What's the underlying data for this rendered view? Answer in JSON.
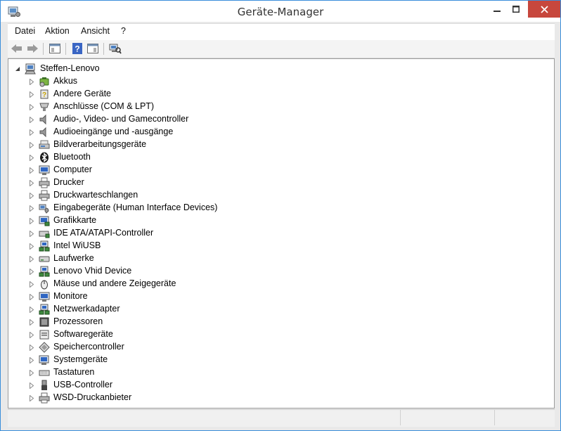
{
  "window": {
    "title": "Geräte-Manager"
  },
  "menu": {
    "items": [
      {
        "label": "Datei",
        "name": "menu-datei"
      },
      {
        "label": "Aktion",
        "name": "menu-aktion"
      },
      {
        "label": "Ansicht",
        "name": "menu-ansicht"
      },
      {
        "label": "?",
        "name": "menu-help"
      }
    ]
  },
  "toolbar": {
    "buttons": [
      "back-icon",
      "forward-icon",
      "properties-view-icon",
      "help-icon",
      "console-tree-icon",
      "scan-hardware-icon"
    ]
  },
  "tree": {
    "root": {
      "label": "Steffen-Lenovo",
      "icon": "computer-root-icon"
    },
    "items": [
      {
        "label": "Akkus",
        "icon": "battery-icon"
      },
      {
        "label": "Andere Geräte",
        "icon": "unknown-device-icon"
      },
      {
        "label": "Anschlüsse (COM & LPT)",
        "icon": "port-icon"
      },
      {
        "label": "Audio-, Video- und Gamecontroller",
        "icon": "speaker-icon"
      },
      {
        "label": "Audioeingänge und -ausgänge",
        "icon": "speaker-icon"
      },
      {
        "label": "Bildverarbeitungsgeräte",
        "icon": "scanner-icon"
      },
      {
        "label": "Bluetooth",
        "icon": "bluetooth-icon"
      },
      {
        "label": "Computer",
        "icon": "monitor-icon"
      },
      {
        "label": "Drucker",
        "icon": "printer-icon"
      },
      {
        "label": "Druckwarteschlangen",
        "icon": "printer-icon"
      },
      {
        "label": "Eingabegeräte (Human Interface Devices)",
        "icon": "hid-icon"
      },
      {
        "label": "Grafikkarte",
        "icon": "display-adapter-icon"
      },
      {
        "label": "IDE ATA/ATAPI-Controller",
        "icon": "drive-controller-icon"
      },
      {
        "label": "Intel WiUSB",
        "icon": "network-device-icon"
      },
      {
        "label": "Laufwerke",
        "icon": "disk-drive-icon"
      },
      {
        "label": "Lenovo Vhid Device",
        "icon": "network-device-icon"
      },
      {
        "label": "Mäuse und andere Zeigegeräte",
        "icon": "mouse-icon"
      },
      {
        "label": "Monitore",
        "icon": "monitor-icon"
      },
      {
        "label": "Netzwerkadapter",
        "icon": "network-device-icon"
      },
      {
        "label": "Prozessoren",
        "icon": "processor-icon"
      },
      {
        "label": "Softwaregeräte",
        "icon": "software-device-icon"
      },
      {
        "label": "Speichercontroller",
        "icon": "storage-controller-icon"
      },
      {
        "label": "Systemgeräte",
        "icon": "system-device-icon"
      },
      {
        "label": "Tastaturen",
        "icon": "keyboard-icon"
      },
      {
        "label": "USB-Controller",
        "icon": "usb-icon"
      },
      {
        "label": "WSD-Druckanbieter",
        "icon": "printer-icon"
      }
    ]
  },
  "colors": {
    "window_border": "#3a8edb",
    "close_button": "#c7473d",
    "expander": "#8a8a8a"
  }
}
